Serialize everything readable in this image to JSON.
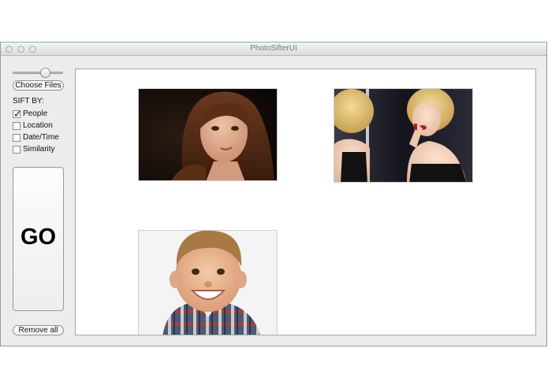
{
  "window": {
    "title": "PhotoSifterUI"
  },
  "sidebar": {
    "choose_files_label": "Choose Files",
    "sift_by_heading": "SIFT BY:",
    "options": [
      {
        "label": "People",
        "checked": true
      },
      {
        "label": "Location",
        "checked": false
      },
      {
        "label": "Date/Time",
        "checked": false
      },
      {
        "label": "Similarity",
        "checked": false
      }
    ],
    "go_label": "GO",
    "remove_all_label": "Remove all",
    "slider_level": 0.68
  },
  "photos": [
    {
      "subject": "girl-portrait"
    },
    {
      "subject": "woman-mirror-lipstick"
    },
    {
      "subject": "smiling-boy"
    }
  ]
}
